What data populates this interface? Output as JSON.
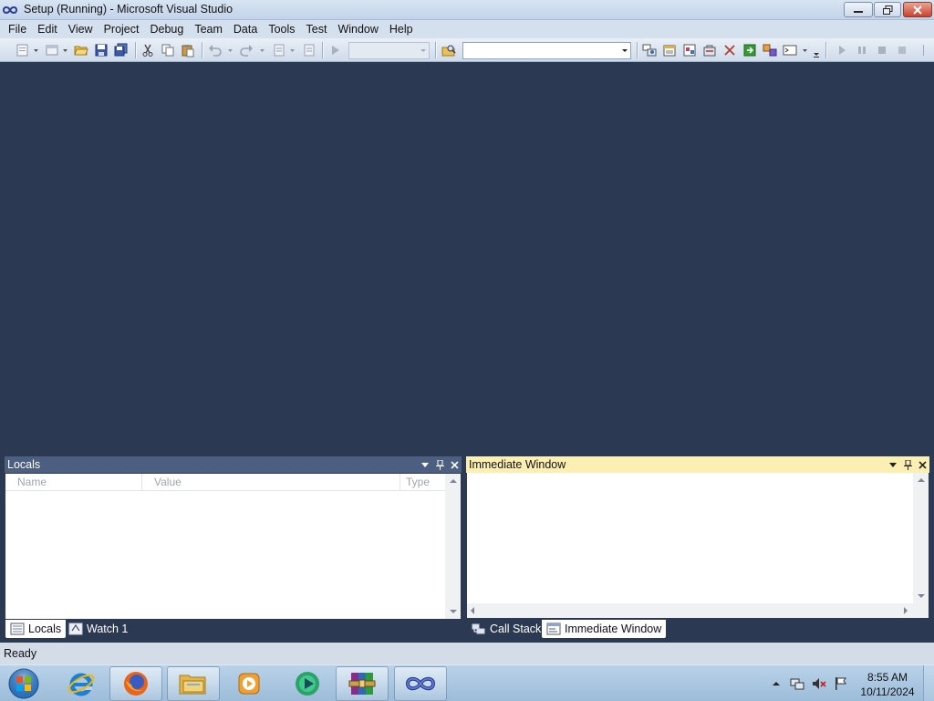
{
  "window": {
    "title": "Setup (Running) - Microsoft Visual Studio",
    "icon": "visual-studio-icon"
  },
  "menu": [
    "File",
    "Edit",
    "View",
    "Project",
    "Debug",
    "Team",
    "Data",
    "Tools",
    "Test",
    "Window",
    "Help"
  ],
  "toolbar": {
    "solution_config": "",
    "find_box": ""
  },
  "locals": {
    "title": "Locals",
    "columns": [
      "Name",
      "Value",
      "Type"
    ]
  },
  "immediate": {
    "title": "Immediate Window",
    "content": ""
  },
  "bottom_tabs": {
    "left": [
      "Locals",
      "Watch 1"
    ],
    "right": [
      "Call Stack",
      "Immediate Window"
    ]
  },
  "status": {
    "text": "Ready"
  },
  "taskbar": {
    "apps": [
      "internet-explorer-icon",
      "firefox-icon",
      "file-explorer-icon",
      "media-player-icon",
      "green-media-icon",
      "winrar-icon",
      "visual-studio-icon"
    ],
    "clock_time": "8:55 AM",
    "clock_date": "10/11/2024"
  },
  "colors": {
    "workspace_bg": "#2b3a52",
    "active_toolwindow_header": "#fcefb3",
    "inactive_toolwindow_header": "#4c5f80"
  }
}
